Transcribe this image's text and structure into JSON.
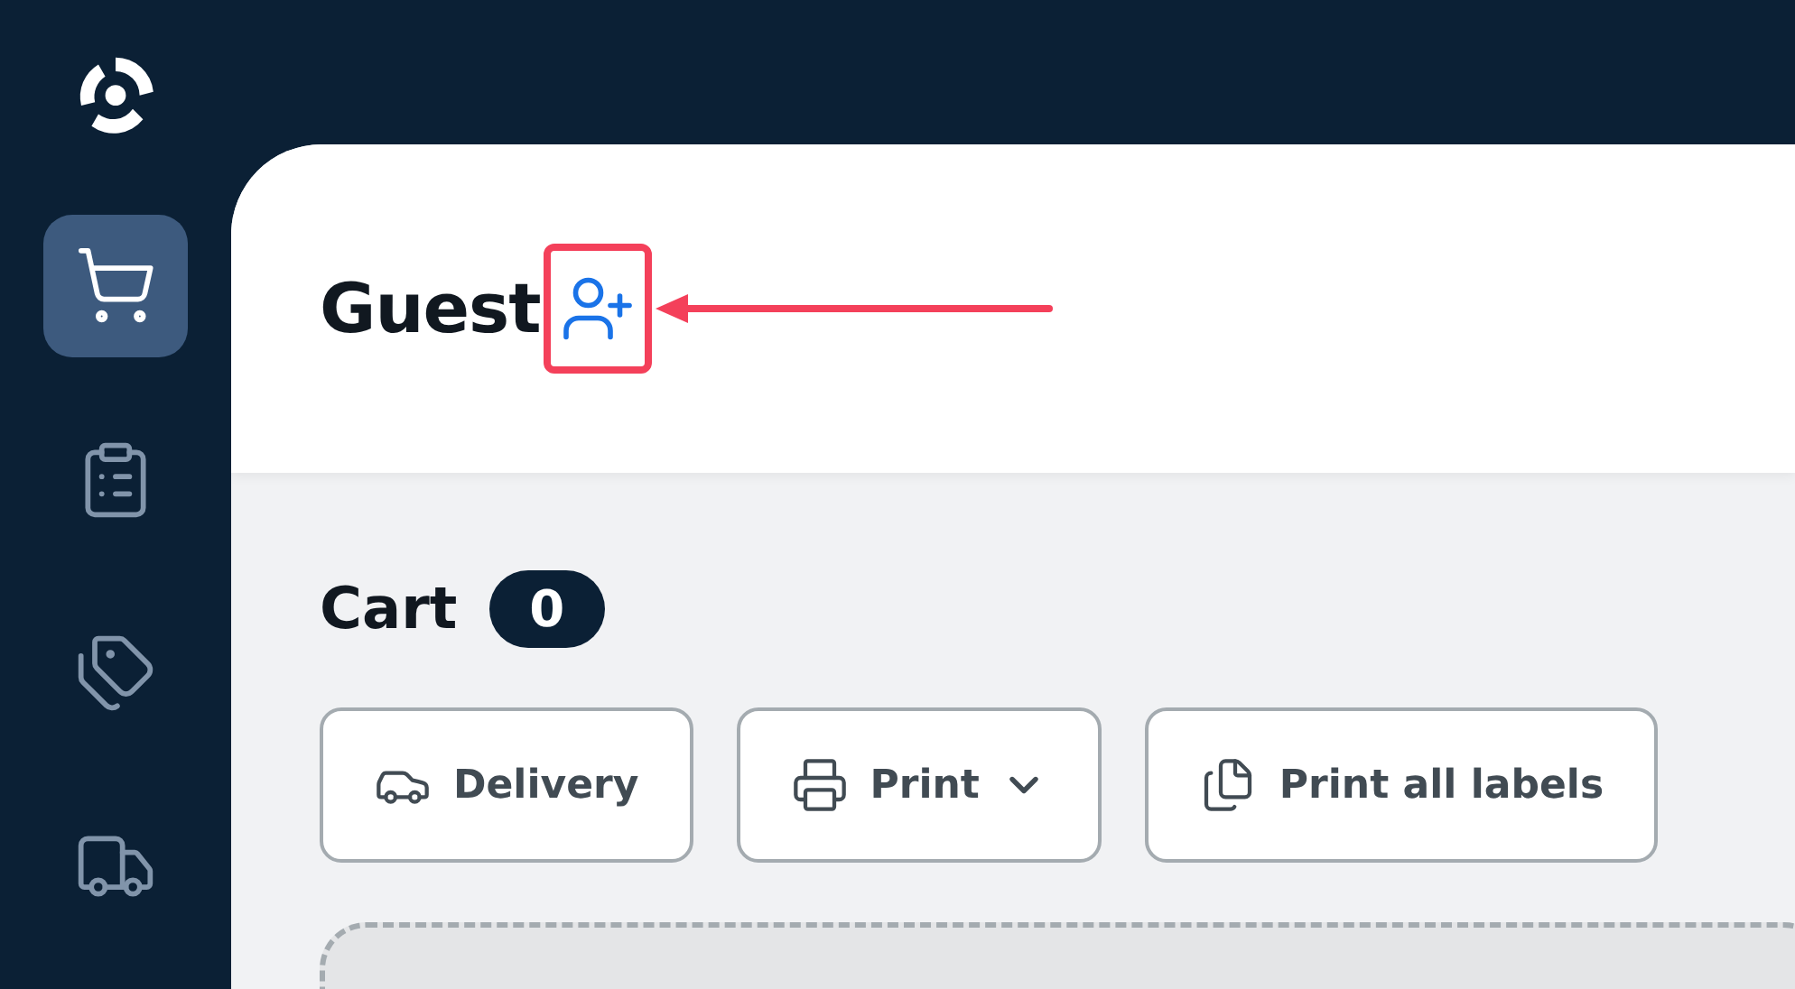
{
  "sidebar": {
    "items": [
      {
        "kind": "cart",
        "selected": true
      },
      {
        "kind": "orders",
        "selected": false
      },
      {
        "kind": "tags",
        "selected": false
      },
      {
        "kind": "delivery",
        "selected": false
      }
    ]
  },
  "header": {
    "title": "Guest",
    "highlighted": true
  },
  "cart": {
    "title": "Cart",
    "count": "0"
  },
  "actions": [
    {
      "kind": "delivery",
      "label": "Delivery",
      "dropdown": false
    },
    {
      "kind": "print",
      "label": "Print",
      "dropdown": true
    },
    {
      "kind": "labels",
      "label": "Print all labels",
      "dropdown": false
    }
  ]
}
